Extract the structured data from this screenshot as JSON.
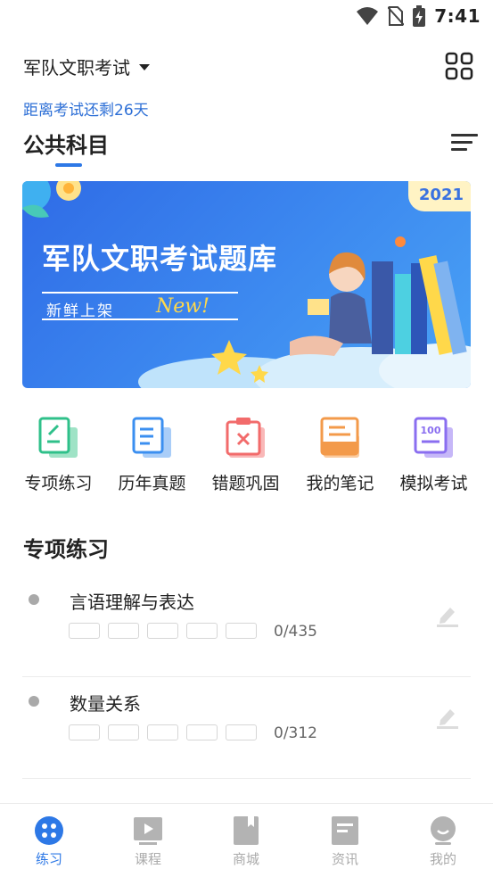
{
  "status_bar": {
    "time": "7:41"
  },
  "header": {
    "exam_name": "军队文职考试"
  },
  "countdown": "距离考试还剩26天",
  "section": {
    "title": "公共科目"
  },
  "banner": {
    "title": "军队文职考试题库",
    "subtitle": "新鲜上架",
    "badge": "New!",
    "year": "2021"
  },
  "features": [
    {
      "label": "专项练习",
      "icon": "practice-icon",
      "color": "#2fc08a"
    },
    {
      "label": "历年真题",
      "icon": "past-papers-icon",
      "color": "#3b8ff0"
    },
    {
      "label": "错题巩固",
      "icon": "wrong-questions-icon",
      "color": "#f26b6b"
    },
    {
      "label": "我的笔记",
      "icon": "notes-icon",
      "color": "#f39a4a"
    },
    {
      "label": "模拟考试",
      "icon": "mock-exam-icon",
      "color": "#8a6ef0",
      "icon_text": "100"
    }
  ],
  "practice_list": {
    "title": "专项练习",
    "items": [
      {
        "name": "言语理解与表达",
        "count": "0/435"
      },
      {
        "name": "数量关系",
        "count": "0/312"
      }
    ]
  },
  "tabs": [
    {
      "label": "练习",
      "icon": "practice-tab-icon",
      "active": true
    },
    {
      "label": "课程",
      "icon": "course-tab-icon",
      "active": false
    },
    {
      "label": "商城",
      "icon": "store-tab-icon",
      "active": false
    },
    {
      "label": "资讯",
      "icon": "news-tab-icon",
      "active": false
    },
    {
      "label": "我的",
      "icon": "profile-tab-icon",
      "active": false
    }
  ],
  "colors": {
    "accent": "#2d78e6",
    "inactive": "#aaaaaa"
  }
}
